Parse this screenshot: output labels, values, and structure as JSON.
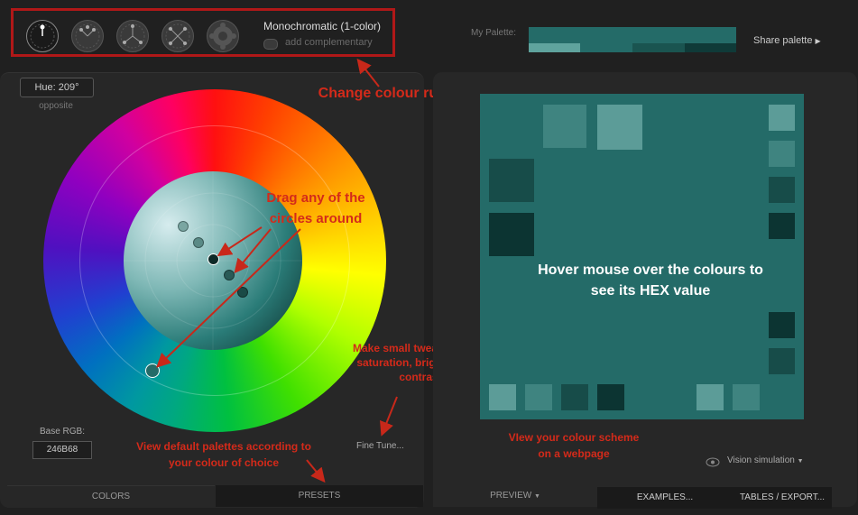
{
  "toolbar": {
    "scheme_title": "Monochromatic (1-color)",
    "add_complementary": "add complementary",
    "rules": [
      {
        "name": "monochromatic",
        "active": true
      },
      {
        "name": "triad",
        "active": false
      },
      {
        "name": "tetrad",
        "active": false
      },
      {
        "name": "tetrad-alt",
        "active": false
      },
      {
        "name": "adjacent",
        "active": false
      }
    ]
  },
  "palette": {
    "label": "My Palette:",
    "share_label": "Share palette",
    "colors": [
      "#246B68",
      "#4A9590",
      "#1A5450",
      "#0F3A38",
      "#0A2826"
    ]
  },
  "hue": {
    "value_label": "Hue: 209°",
    "sub_label": "opposite"
  },
  "base_rgb": {
    "label": "Base RGB:",
    "value": "246B68"
  },
  "fine_tune_label": "Fine Tune...",
  "left_tabs": {
    "colors": "COLORS",
    "presets": "PRESETS"
  },
  "right_tabs": {
    "preview": "PREVIEW",
    "examples": "EXAMPLES...",
    "tables": "TABLES / EXPORT..."
  },
  "vision_label": "Vision simulation",
  "annotations": {
    "change_rules": "Change colour rules",
    "drag": "Drag any of the circles around",
    "hover": "Hover mouse over the colours to see its HEX value",
    "tweaks": "Make small tweaks to hue, saturation, brightness or contrast",
    "presets": "View default palettes according to your colour of choice",
    "webpage": "VIew your colour scheme on a webpage"
  },
  "colors": {
    "base": "#246B68",
    "light": "#4A9590",
    "lighter": "#5FA39D",
    "dark": "#1A5450",
    "darker": "#0F3A38",
    "annotation": "#D42A1A"
  }
}
